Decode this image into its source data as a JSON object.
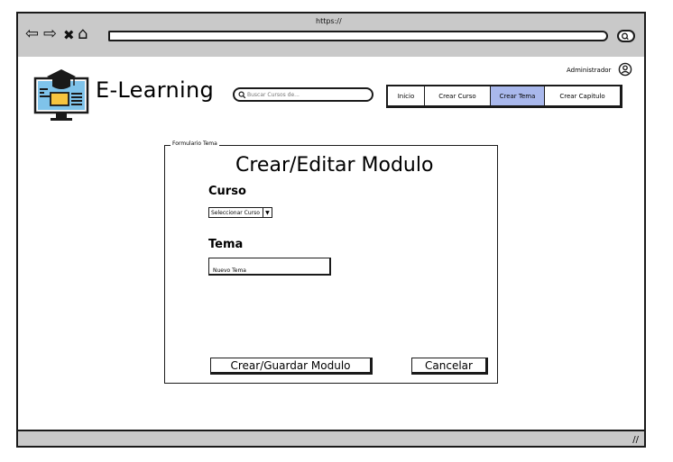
{
  "browser": {
    "url": "https://",
    "back_icon": "back-arrow-icon",
    "forward_icon": "forward-arrow-icon",
    "close_icon": "close-icon",
    "home_icon": "home-icon"
  },
  "header": {
    "brand": "E-Learning",
    "search_placeholder": "Buscar Cursos de...",
    "user_label": "Administrador",
    "nav": [
      {
        "label": "Inicio",
        "active": false
      },
      {
        "label": "Crear Curso",
        "active": false
      },
      {
        "label": "Crear Tema",
        "active": true
      },
      {
        "label": "Crear Capitulo",
        "active": false
      }
    ],
    "active_color": "#a9b8ec"
  },
  "form": {
    "legend": "Formulario Tema",
    "title": "Crear/Editar Modulo",
    "course_label": "Curso",
    "course_select_value": "Seleccionar Curso",
    "topic_label": "Tema",
    "topic_value": "Nuevo Tema",
    "save_button": "Crear/Guardar Modulo",
    "cancel_button": "Cancelar"
  }
}
